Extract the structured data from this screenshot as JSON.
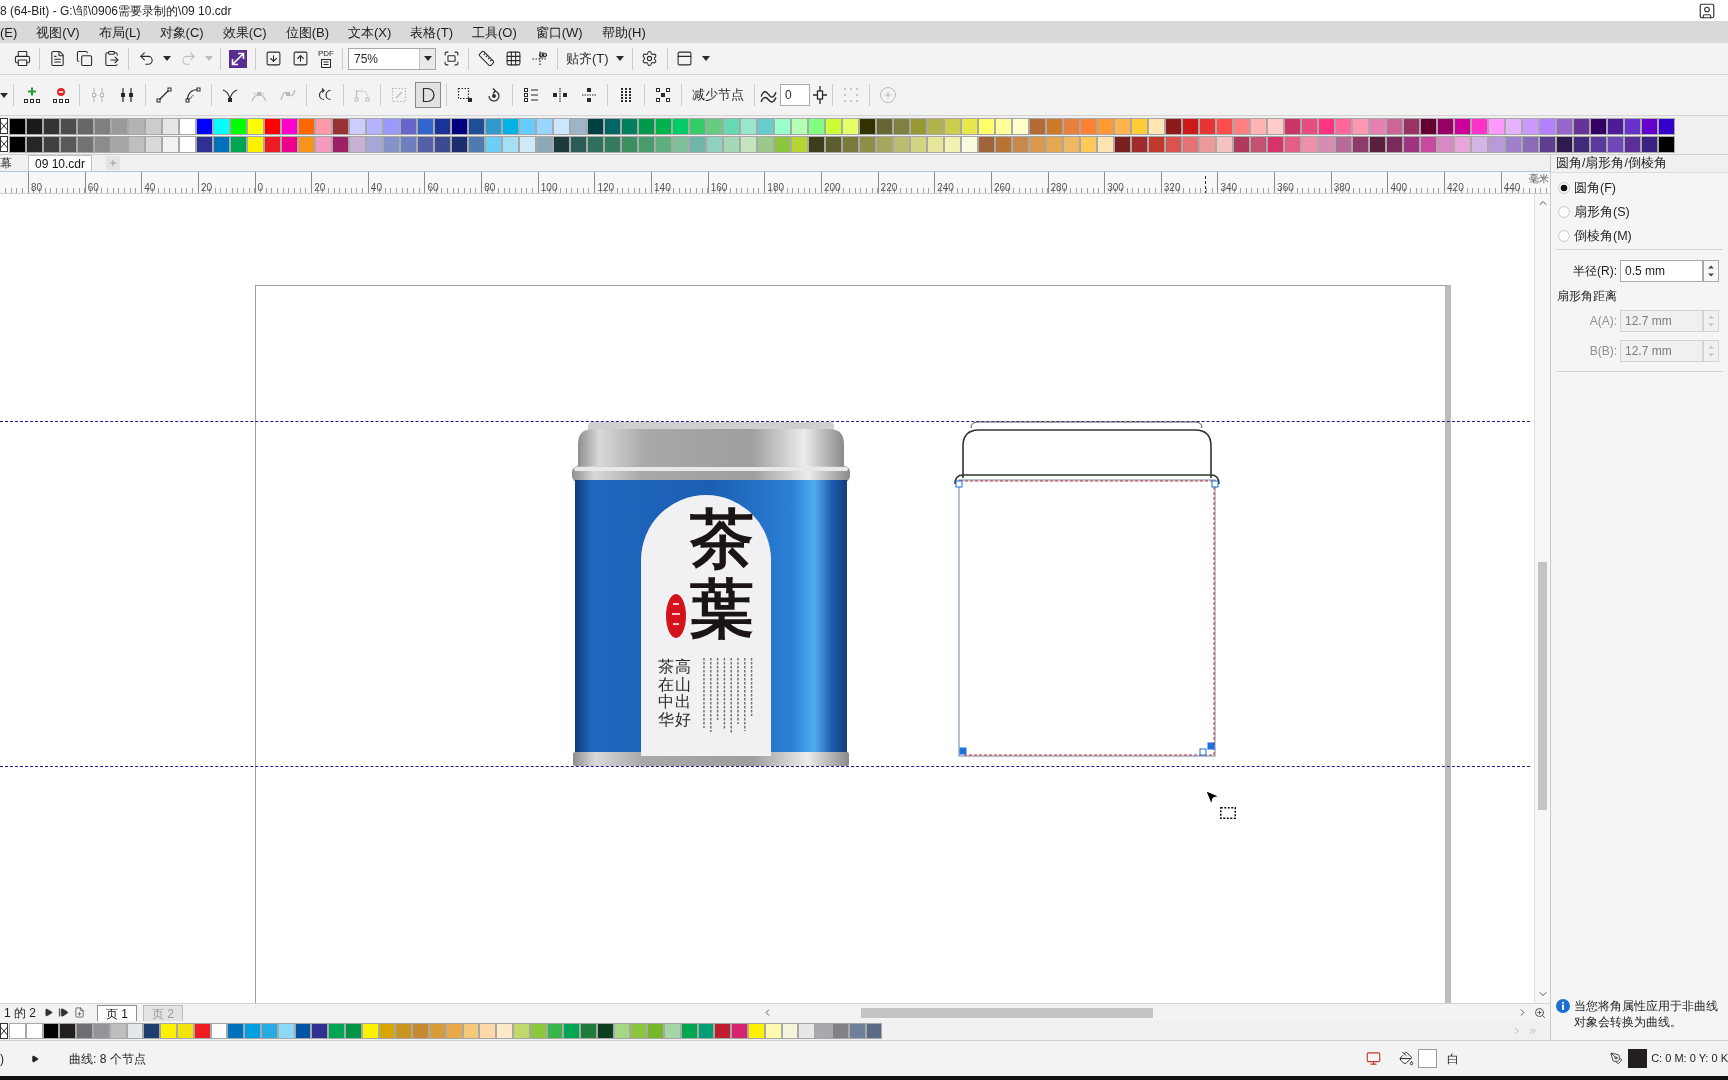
{
  "title_bar": {
    "title": "8 (64-Bit) - G:\\邹\\0906需要录制的\\09 10.cdr"
  },
  "menu_bar": {
    "items": [
      "(E)",
      "视图(V)",
      "布局(L)",
      "对象(C)",
      "效果(C)",
      "位图(B)",
      "文本(X)",
      "表格(T)",
      "工具(O)",
      "窗口(W)",
      "帮助(H)"
    ]
  },
  "standard_toolbar": {
    "groups": [
      [
        {
          "kind": "print",
          "disabled": false
        }
      ],
      [
        {
          "kind": "document",
          "disabled": false
        },
        {
          "kind": "copy",
          "disabled": false
        },
        {
          "kind": "paste",
          "disabled": false
        }
      ],
      [
        {
          "kind": "undo",
          "disabled": false
        },
        {
          "kind": "caret",
          "disabled": false
        },
        {
          "kind": "redo",
          "disabled": true
        },
        {
          "kind": "caret",
          "disabled": true
        }
      ],
      [
        {
          "kind": "launcher",
          "disabled": false
        }
      ],
      [
        {
          "kind": "import",
          "disabled": false
        },
        {
          "kind": "export",
          "disabled": false
        },
        {
          "kind": "pdf",
          "label": "PDF",
          "disabled": false
        }
      ],
      [
        {
          "kind": "zoom_box",
          "value": "75%",
          "disabled": false
        },
        {
          "kind": "fullscreen",
          "disabled": false
        }
      ],
      [
        {
          "kind": "rulers",
          "disabled": false
        },
        {
          "kind": "grid",
          "disabled": false
        },
        {
          "kind": "guidelines",
          "disabled": false
        }
      ],
      [
        {
          "kind": "dropdown",
          "label": "贴齐(T)",
          "disabled": false
        }
      ],
      [
        {
          "kind": "settings",
          "disabled": false
        }
      ],
      [
        {
          "kind": "layout",
          "disabled": false
        },
        {
          "kind": "caret",
          "disabled": false
        }
      ]
    ]
  },
  "property_bar": {
    "groups": [
      [
        {
          "kind": "caret",
          "disabled": false,
          "pressed": false
        }
      ],
      [
        {
          "kind": "add_node",
          "disabled": false,
          "pressed": false
        },
        {
          "kind": "delete_node",
          "disabled": false,
          "pressed": false
        }
      ],
      [
        {
          "kind": "join_nodes",
          "disabled": true,
          "pressed": false
        },
        {
          "kind": "break_curve",
          "disabled": false,
          "pressed": false
        }
      ],
      [
        {
          "kind": "to_line",
          "disabled": false,
          "pressed": false
        },
        {
          "kind": "to_curve",
          "disabled": false,
          "pressed": false
        }
      ],
      [
        {
          "kind": "cusp",
          "disabled": false,
          "pressed": false
        },
        {
          "kind": "smooth",
          "disabled": true,
          "pressed": false
        },
        {
          "kind": "symmetric",
          "disabled": true,
          "pressed": false
        }
      ],
      [
        {
          "kind": "reverse",
          "disabled": false,
          "pressed": false
        }
      ],
      [
        {
          "kind": "extend_close",
          "disabled": true,
          "pressed": false
        }
      ],
      [
        {
          "kind": "extract",
          "disabled": true,
          "pressed": false
        },
        {
          "kind": "close_curve",
          "disabled": false,
          "pressed": true
        }
      ],
      [
        {
          "kind": "stretch",
          "disabled": false,
          "pressed": false
        },
        {
          "kind": "rotate",
          "disabled": false,
          "pressed": false
        }
      ],
      [
        {
          "kind": "align",
          "disabled": false,
          "pressed": false
        },
        {
          "kind": "h_reflect",
          "disabled": false,
          "pressed": false
        },
        {
          "kind": "v_reflect",
          "disabled": false,
          "pressed": false
        }
      ],
      [
        {
          "kind": "elastic",
          "disabled": false,
          "pressed": false
        }
      ],
      [
        {
          "kind": "select_all",
          "disabled": false,
          "pressed": false
        }
      ],
      [
        {
          "kind": "text_button",
          "label": "减少节点",
          "disabled": false,
          "pressed": false
        }
      ],
      [
        {
          "kind": "smoothness",
          "value": "0",
          "disabled": false,
          "pressed": false
        }
      ],
      [
        {
          "kind": "dotted",
          "disabled": true,
          "pressed": false
        }
      ],
      [
        {
          "kind": "plus_circle",
          "disabled": true,
          "pressed": false
        }
      ]
    ]
  },
  "color_palette": {
    "rows": [
      [
        {
          "color": "#000000"
        },
        {
          "color": "#1a1a1a"
        },
        {
          "color": "#333333"
        },
        {
          "color": "#4d4d4d"
        },
        {
          "color": "#666666"
        },
        {
          "color": "#808080"
        },
        {
          "color": "#999999"
        },
        {
          "color": "#b3b3b3"
        },
        {
          "color": "#cccccc"
        },
        {
          "color": "#e6e6e6"
        },
        {
          "color": "#ffffff"
        },
        {
          "color": "#0000ff"
        },
        {
          "color": "#00ffff"
        },
        {
          "color": "#00ff00"
        },
        {
          "color": "#ffff00"
        },
        {
          "color": "#ff0000"
        },
        {
          "color": "#ff00cc"
        },
        {
          "color": "#ff6600"
        },
        {
          "color": "#ff99aa"
        },
        {
          "color": "#993333"
        },
        {
          "color": "#ccccff"
        },
        {
          "color": "#b3b3ff"
        },
        {
          "color": "#9999ff"
        },
        {
          "color": "#6666cc"
        },
        {
          "color": "#3366cc"
        },
        {
          "color": "#1a3399"
        },
        {
          "color": "#000080"
        },
        {
          "color": "#1f4e99"
        },
        {
          "color": "#3399cc"
        },
        {
          "color": "#00b3e6"
        },
        {
          "color": "#66ccff"
        },
        {
          "color": "#99d6ff"
        },
        {
          "color": "#cce6ff"
        },
        {
          "color": "#9fb4c7"
        },
        {
          "color": "#004040"
        },
        {
          "color": "#006666"
        },
        {
          "color": "#00805f"
        },
        {
          "color": "#00994d"
        },
        {
          "color": "#00b34d"
        },
        {
          "color": "#00cc66"
        },
        {
          "color": "#33cc66"
        },
        {
          "color": "#66cc80"
        },
        {
          "color": "#66d9b3"
        },
        {
          "color": "#99e6cc"
        },
        {
          "color": "#66cccc"
        },
        {
          "color": "#99ffcc"
        },
        {
          "color": "#b3ffb3"
        },
        {
          "color": "#80ff80"
        },
        {
          "color": "#ccff33"
        },
        {
          "color": "#e6ff66"
        },
        {
          "color": "#333300"
        },
        {
          "color": "#666633"
        },
        {
          "color": "#808040"
        },
        {
          "color": "#999933"
        },
        {
          "color": "#b3b34d"
        },
        {
          "color": "#cccc4d"
        },
        {
          "color": "#e6e64d"
        },
        {
          "color": "#ffff66"
        },
        {
          "color": "#ffff99"
        },
        {
          "color": "#ffffcc"
        },
        {
          "color": "#b36b33"
        },
        {
          "color": "#cc7a29"
        },
        {
          "color": "#e6803a"
        },
        {
          "color": "#ff8033"
        },
        {
          "color": "#ff9933"
        },
        {
          "color": "#ffb34d"
        },
        {
          "color": "#ffcc33"
        },
        {
          "color": "#ffe6b3"
        },
        {
          "color": "#8c1a1a"
        },
        {
          "color": "#cc1a1a"
        },
        {
          "color": "#e63333"
        },
        {
          "color": "#ff4d4d"
        },
        {
          "color": "#ff8080"
        },
        {
          "color": "#ffb3b3"
        },
        {
          "color": "#ffcccc"
        },
        {
          "color": "#cc3366"
        },
        {
          "color": "#e64d80"
        },
        {
          "color": "#ff3380"
        },
        {
          "color": "#ff6699"
        },
        {
          "color": "#ff99b3"
        },
        {
          "color": "#e680b3"
        },
        {
          "color": "#cc6699"
        },
        {
          "color": "#993366"
        },
        {
          "color": "#660033"
        },
        {
          "color": "#990066"
        },
        {
          "color": "#cc0099"
        },
        {
          "color": "#ff33cc"
        },
        {
          "color": "#ff99ff"
        },
        {
          "color": "#e6b3ff"
        },
        {
          "color": "#cc99ff"
        },
        {
          "color": "#b380ff"
        },
        {
          "color": "#9966cc"
        },
        {
          "color": "#663399"
        },
        {
          "color": "#330066"
        },
        {
          "color": "#4d1a99"
        },
        {
          "color": "#6633cc"
        },
        {
          "color": "#6600cc"
        },
        {
          "color": "#3300cc"
        }
      ],
      [
        {
          "color": "#000000"
        },
        {
          "color": "#262626"
        },
        {
          "color": "#404040"
        },
        {
          "color": "#595959"
        },
        {
          "color": "#737373"
        },
        {
          "color": "#8c8c8c"
        },
        {
          "color": "#a6a6a6"
        },
        {
          "color": "#bfbfbf"
        },
        {
          "color": "#d9d9d9"
        },
        {
          "color": "#f2f2f2"
        },
        {
          "color": "#ffffff"
        },
        {
          "color": "#2e3192"
        },
        {
          "color": "#0072bc"
        },
        {
          "color": "#00a651"
        },
        {
          "color": "#fff200"
        },
        {
          "color": "#ed1c24"
        },
        {
          "color": "#ec008c"
        },
        {
          "color": "#f7941d"
        },
        {
          "color": "#f49ac1"
        },
        {
          "color": "#9e1f63"
        },
        {
          "color": "#c7b2d6"
        },
        {
          "color": "#a3a8d6"
        },
        {
          "color": "#8393ca"
        },
        {
          "color": "#6d7fbf"
        },
        {
          "color": "#5560a8"
        },
        {
          "color": "#3c4a8f"
        },
        {
          "color": "#1c2e6e"
        },
        {
          "color": "#4f7cb0"
        },
        {
          "color": "#6dcff6"
        },
        {
          "color": "#a5def5"
        },
        {
          "color": "#d0ebf7"
        },
        {
          "color": "#8fa8b8"
        },
        {
          "color": "#1d3b3b"
        },
        {
          "color": "#2b5b55"
        },
        {
          "color": "#2e6f5e"
        },
        {
          "color": "#347a5c"
        },
        {
          "color": "#3b8f60"
        },
        {
          "color": "#4a9c6d"
        },
        {
          "color": "#5fae80"
        },
        {
          "color": "#80c09a"
        },
        {
          "color": "#6fb5a8"
        },
        {
          "color": "#8fd0c0"
        },
        {
          "color": "#a6d8b8"
        },
        {
          "color": "#c5e4c0"
        },
        {
          "color": "#9bc98a"
        },
        {
          "color": "#8cc63f"
        },
        {
          "color": "#b8d432"
        },
        {
          "color": "#3d3d1a"
        },
        {
          "color": "#5c5c2e"
        },
        {
          "color": "#7a7a3d"
        },
        {
          "color": "#8f8f47"
        },
        {
          "color": "#a6a65c"
        },
        {
          "color": "#bdbd70"
        },
        {
          "color": "#d4d485"
        },
        {
          "color": "#e6e69a"
        },
        {
          "color": "#f2f2b3"
        },
        {
          "color": "#fafae0"
        },
        {
          "color": "#a0643a"
        },
        {
          "color": "#b87333"
        },
        {
          "color": "#c88a4a"
        },
        {
          "color": "#d99a50"
        },
        {
          "color": "#e6a84f"
        },
        {
          "color": "#f0b860"
        },
        {
          "color": "#ffc857"
        },
        {
          "color": "#ffe3b0"
        },
        {
          "color": "#7a1f1f"
        },
        {
          "color": "#a12a2a"
        },
        {
          "color": "#c0392b"
        },
        {
          "color": "#d9534f"
        },
        {
          "color": "#e57373"
        },
        {
          "color": "#ef9a9a"
        },
        {
          "color": "#f5c2c2"
        },
        {
          "color": "#b03a5b"
        },
        {
          "color": "#c2526f"
        },
        {
          "color": "#d6336c"
        },
        {
          "color": "#e55d87"
        },
        {
          "color": "#f08fa8"
        },
        {
          "color": "#d98cb3"
        },
        {
          "color": "#b86b99"
        },
        {
          "color": "#8e3b6b"
        },
        {
          "color": "#5a1f3d"
        },
        {
          "color": "#7b2a5c"
        },
        {
          "color": "#a0337f"
        },
        {
          "color": "#c84a9e"
        },
        {
          "color": "#d98ac4"
        },
        {
          "color": "#e6a6d9"
        },
        {
          "color": "#d4b3e6"
        },
        {
          "color": "#b89ad9"
        },
        {
          "color": "#a080cc"
        },
        {
          "color": "#8a6bb8"
        },
        {
          "color": "#5f3d8f"
        },
        {
          "color": "#2e1a4d"
        },
        {
          "color": "#43297a"
        },
        {
          "color": "#5a3a9e"
        },
        {
          "color": "#7047b8"
        },
        {
          "color": "#5c2e99"
        },
        {
          "color": "#3a2080"
        },
        {
          "color": "#000000"
        }
      ]
    ]
  },
  "document_tabs": {
    "tabs": [
      {
        "label": "幕",
        "selected": false
      },
      {
        "label": "09 10.cdr",
        "selected": true
      }
    ]
  },
  "ruler": {
    "labels": [
      "80",
      "60",
      "40",
      "20",
      "0",
      "20",
      "40",
      "60",
      "80",
      "100",
      "120",
      "140",
      "160",
      "180",
      "200",
      "220",
      "240",
      "260",
      "280",
      "300",
      "320",
      "340",
      "360",
      "380",
      "400",
      "420",
      "440"
    ],
    "unit": "毫米"
  },
  "canvas": {
    "tea_can": {
      "brand": "茶葉",
      "slogan_columns": [
        "茶在中华",
        "高山出好"
      ]
    }
  },
  "corner_panel": {
    "title": "圆角/扇形角/倒棱角",
    "options": [
      {
        "label": "圆角(F)",
        "selected": true
      },
      {
        "label": "扇形角(S)",
        "selected": false
      },
      {
        "label": "倒棱角(M)",
        "selected": false
      }
    ],
    "radius": {
      "label": "半径(R):",
      "value": "0.5 mm"
    },
    "distance_heading": "扇形角距离",
    "distances": [
      {
        "label": "A(A):",
        "value": "12.7 mm",
        "disabled": true
      },
      {
        "label": "B(B):",
        "value": "12.7 mm",
        "disabled": true
      }
    ],
    "note": "当您将角属性应用于非曲线对象会转换为曲线。"
  },
  "page_navigator": {
    "position": "1 的 2",
    "pages": [
      {
        "label": "页 1",
        "selected": true
      },
      {
        "label": "页 2",
        "selected": false
      }
    ]
  },
  "document_palette": {
    "swatches": [
      {
        "color": "#ffffff"
      },
      {
        "color": "#ffffff"
      },
      {
        "color": "#000000"
      },
      {
        "color": "#231f20"
      },
      {
        "color": "#6d6e71"
      },
      {
        "color": "#939598"
      },
      {
        "color": "#bcbec0"
      },
      {
        "color": "#e6e7e8"
      },
      {
        "color": "#1c3f6e"
      },
      {
        "color": "#fff200"
      },
      {
        "color": "#f2e30f"
      },
      {
        "color": "#ed1c24"
      },
      {
        "color": "#ffffff"
      },
      {
        "color": "#0072bc"
      },
      {
        "color": "#00a0e3"
      },
      {
        "color": "#29abe2"
      },
      {
        "color": "#8ed8f8"
      },
      {
        "color": "#0054a6"
      },
      {
        "color": "#2e3192"
      },
      {
        "color": "#00a651"
      },
      {
        "color": "#009444"
      },
      {
        "color": "#fff200"
      },
      {
        "color": "#d7a700"
      },
      {
        "color": "#c8961e"
      },
      {
        "color": "#c7892e"
      },
      {
        "color": "#d89b3a"
      },
      {
        "color": "#e8a94a"
      },
      {
        "color": "#f6c87a"
      },
      {
        "color": "#fbd9a8"
      },
      {
        "color": "#fde9c8"
      },
      {
        "color": "#c2d96b"
      },
      {
        "color": "#8dc63f"
      },
      {
        "color": "#39b54a"
      },
      {
        "color": "#00a651"
      },
      {
        "color": "#1e7b3a"
      },
      {
        "color": "#0b3d21"
      },
      {
        "color": "#a6d785"
      },
      {
        "color": "#8cc63f"
      },
      {
        "color": "#77b82a"
      },
      {
        "color": "#a5d6a7"
      },
      {
        "color": "#00a651"
      },
      {
        "color": "#009e73"
      },
      {
        "color": "#be1e2d"
      },
      {
        "color": "#d6246e"
      },
      {
        "color": "#fff200"
      },
      {
        "color": "#fff9ae"
      },
      {
        "color": "#f5f5dc"
      },
      {
        "color": "#e6e7e8"
      },
      {
        "color": "#a7a9ac"
      },
      {
        "color": "#808285"
      },
      {
        "color": "#6d7f99"
      },
      {
        "color": "#5a6b85"
      }
    ]
  },
  "status_bar": {
    "prefix": ")",
    "message": "曲线: 8 个节点",
    "fill": {
      "name": "白",
      "color": "#ffffff"
    },
    "outline": {
      "color": "#231f20",
      "values": "C: 0 M: 0 Y: 0 K"
    }
  }
}
